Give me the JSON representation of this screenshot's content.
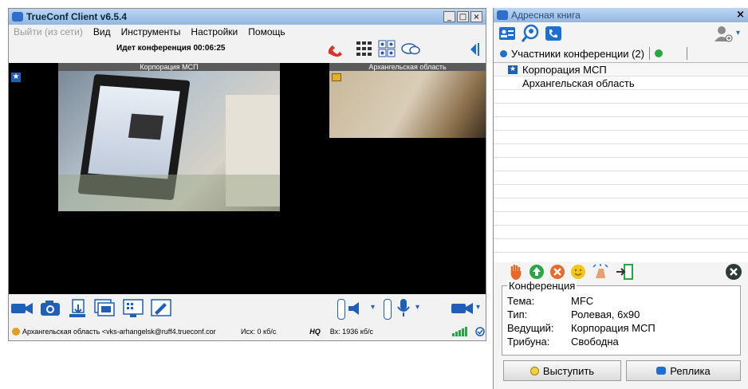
{
  "left_window": {
    "title": "TrueConf Client v6.5.4",
    "controls": {
      "minimize": "_",
      "maximize": "□",
      "close": "×"
    },
    "menu": [
      {
        "label": "Выйти (из сети)",
        "disabled": true
      },
      {
        "label": "Вид"
      },
      {
        "label": "Инструменты"
      },
      {
        "label": "Настройки"
      },
      {
        "label": "Помощь"
      }
    ],
    "conference_status": "Идет конференция 00:06:25",
    "main_video_label": "Корпорация МСП",
    "secondary_video_label": "Архангельская область",
    "status_bar": {
      "user": "Архангельская область <vks-arhangelsk@ruff4.trueconf.cor",
      "outgoing": "Исх: 0 кб/с",
      "quality": "HQ",
      "incoming": "Вх: 1936 кб/с"
    }
  },
  "right_window": {
    "title": "Адресная книга",
    "tab_label": "Участники конференции (2)",
    "participants": [
      "Корпорация МСП",
      "Архангельская область"
    ],
    "info": {
      "legend": "Конференция",
      "rows": [
        {
          "k": "Тема:",
          "v": "MFC"
        },
        {
          "k": "Тип:",
          "v": "Ролевая, 6x90"
        },
        {
          "k": "Ведущий:",
          "v": "Корпорация МСП"
        },
        {
          "k": "Трибуна:",
          "v": "Свободна"
        }
      ]
    },
    "buttons": {
      "speak": "Выступить",
      "reply": "Реплика"
    }
  },
  "colors": {
    "accent": "#1f6fd0",
    "green": "#28a745",
    "red": "#e03a2e"
  }
}
